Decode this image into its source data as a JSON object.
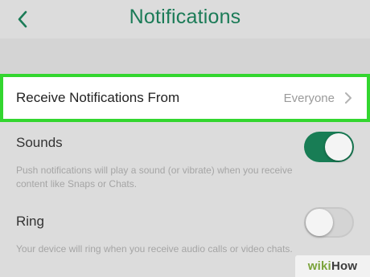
{
  "header": {
    "title": "Notifications",
    "back_icon": "chevron-left-icon"
  },
  "receive_row": {
    "label": "Receive Notifications From",
    "value": "Everyone",
    "chevron_icon": "chevron-right-icon",
    "highlight_color": "#33d62f"
  },
  "sounds": {
    "title": "Sounds",
    "description": "Push notifications will play a sound (or vibrate) when you receive content like Snaps or Chats.",
    "enabled": true
  },
  "ring": {
    "title": "Ring",
    "description": "Your device will ring when you receive audio calls or video chats.",
    "enabled": false
  },
  "colors": {
    "accent": "#1b7b57",
    "toggle_on": "#187d55"
  },
  "watermark": {
    "wiki": "wiki",
    "how": "How"
  }
}
